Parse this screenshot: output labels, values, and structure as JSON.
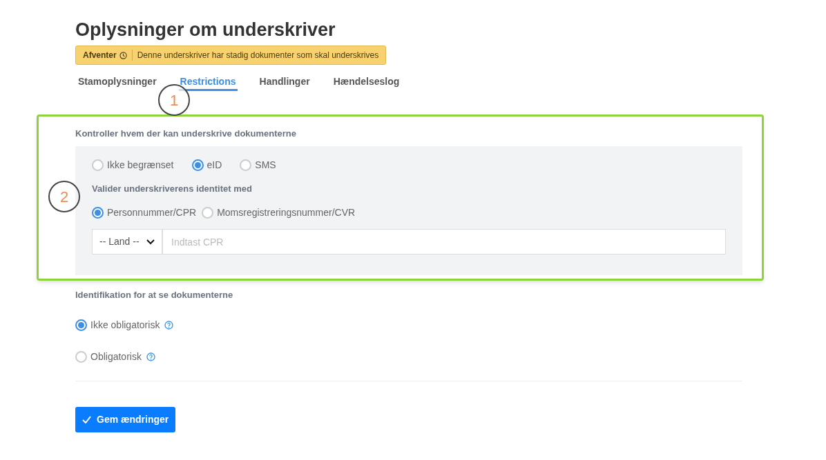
{
  "title": "Oplysninger om underskriver",
  "status_badge": {
    "status": "Afventer",
    "message": "Denne underskriver har stadig dokumenter som skal underskrives"
  },
  "tabs": [
    {
      "label": "Stamoplysninger",
      "selected": false
    },
    {
      "label": "Restrictions",
      "selected": true
    },
    {
      "label": "Handlinger",
      "selected": false
    },
    {
      "label": "Hændelseslog",
      "selected": false
    }
  ],
  "signing_control": {
    "heading": "Kontroller hvem der kan underskrive dokumenterne",
    "methods": [
      {
        "label": "Ikke begrænset",
        "selected": false
      },
      {
        "label": "eID",
        "selected": true
      },
      {
        "label": "SMS",
        "selected": false
      }
    ],
    "validate_heading": "Valider underskriverens identitet med",
    "id_types": [
      {
        "label": "Personnummer/CPR",
        "selected": true
      },
      {
        "label": "Momsregistreringsnummer/CVR",
        "selected": false
      }
    ],
    "country_select": "-- Land --",
    "id_field": {
      "placeholder": "Indtast CPR"
    }
  },
  "view_identification": {
    "heading": "Identifikation for at se dokumenterne",
    "options": [
      {
        "label": "Ikke obligatorisk",
        "selected": true
      },
      {
        "label": "Obligatorisk",
        "selected": false
      }
    ]
  },
  "save_button": "Gem ændringer",
  "callouts": [
    "1",
    "2"
  ]
}
